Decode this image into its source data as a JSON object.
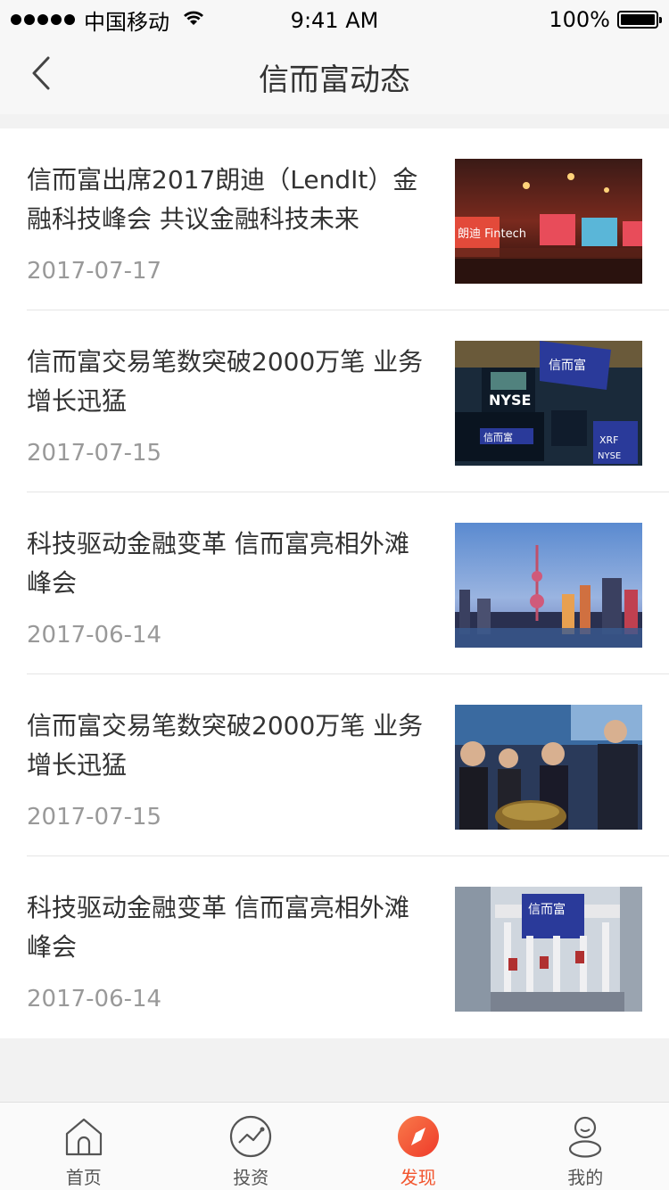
{
  "status_bar": {
    "carrier": "中国移动",
    "time": "9:41 AM",
    "battery": "100%"
  },
  "nav": {
    "title": "信而富动态"
  },
  "news": [
    {
      "title": "信而富出席2017朗迪（LendIt）金融科技峰会 共议金融科技未来",
      "date": "2017-07-17",
      "image": "conference-stage"
    },
    {
      "title": "信而富交易笔数突破2000万笔 业务增长迅猛",
      "date": "2017-07-15",
      "image": "nyse-screens"
    },
    {
      "title": "科技驱动金融变革 信而富亮相外滩峰会",
      "date": "2017-06-14",
      "image": "shanghai-skyline"
    },
    {
      "title": "信而富交易笔数突破2000万笔 业务增长迅猛",
      "date": "2017-07-15",
      "image": "bell-ringing-crowd"
    },
    {
      "title": "科技驱动金融变革 信而富亮相外滩峰会",
      "date": "2017-06-14",
      "image": "nyse-building"
    }
  ],
  "tabs": [
    {
      "label": "首页",
      "icon": "home-icon",
      "active": false
    },
    {
      "label": "投资",
      "icon": "trend-icon",
      "active": false
    },
    {
      "label": "发现",
      "icon": "compass-icon",
      "active": true
    },
    {
      "label": "我的",
      "icon": "user-icon",
      "active": false
    }
  ],
  "colors": {
    "accent": "#f2542d",
    "text_primary": "#333333",
    "text_secondary": "#999999",
    "background": "#f2f2f2"
  }
}
